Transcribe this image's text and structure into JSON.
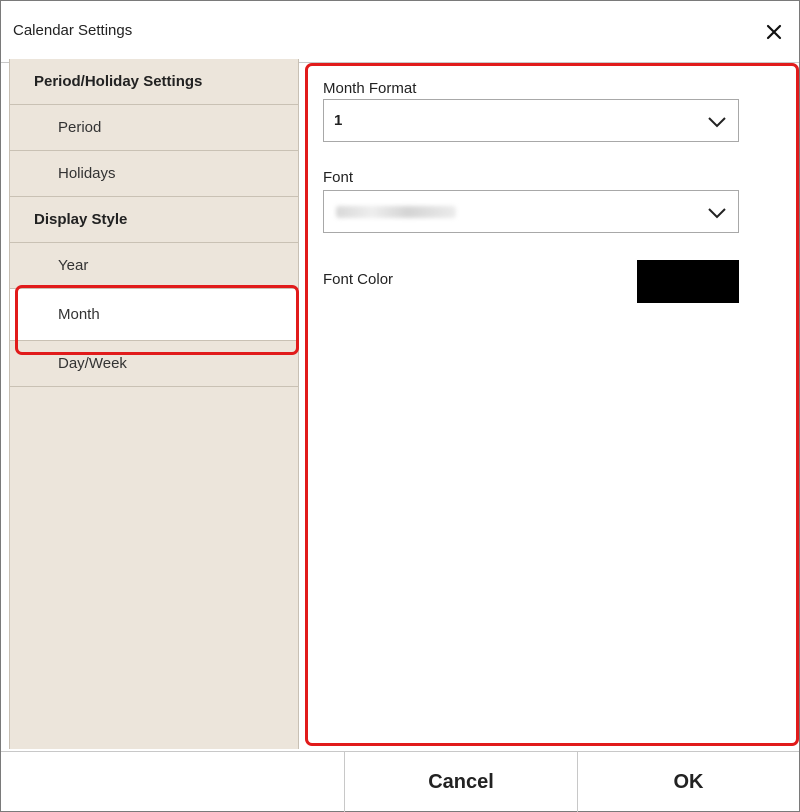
{
  "dialog": {
    "title": "Calendar Settings",
    "close_icon": "close-icon"
  },
  "sidebar": {
    "items": [
      {
        "label": "Period/Holiday Settings",
        "type": "header"
      },
      {
        "label": "Period",
        "type": "sub"
      },
      {
        "label": "Holidays",
        "type": "sub"
      },
      {
        "label": "Display Style",
        "type": "header"
      },
      {
        "label": "Year",
        "type": "sub"
      },
      {
        "label": "Month",
        "type": "sub",
        "selected": true
      },
      {
        "label": "Day/Week",
        "type": "sub"
      }
    ]
  },
  "content": {
    "month_format": {
      "label": "Month Format",
      "value": "1",
      "icon": "chevron-down-icon"
    },
    "font": {
      "label": "Font",
      "value_blurred": true,
      "icon": "chevron-down-icon"
    },
    "font_color": {
      "label": "Font Color",
      "color": "#000000"
    }
  },
  "footer": {
    "cancel_label": "Cancel",
    "ok_label": "OK"
  },
  "colors": {
    "sidebar_bg": "#ece5db",
    "highlight": "#e11b1b",
    "selected_bg": "#ffffff"
  }
}
